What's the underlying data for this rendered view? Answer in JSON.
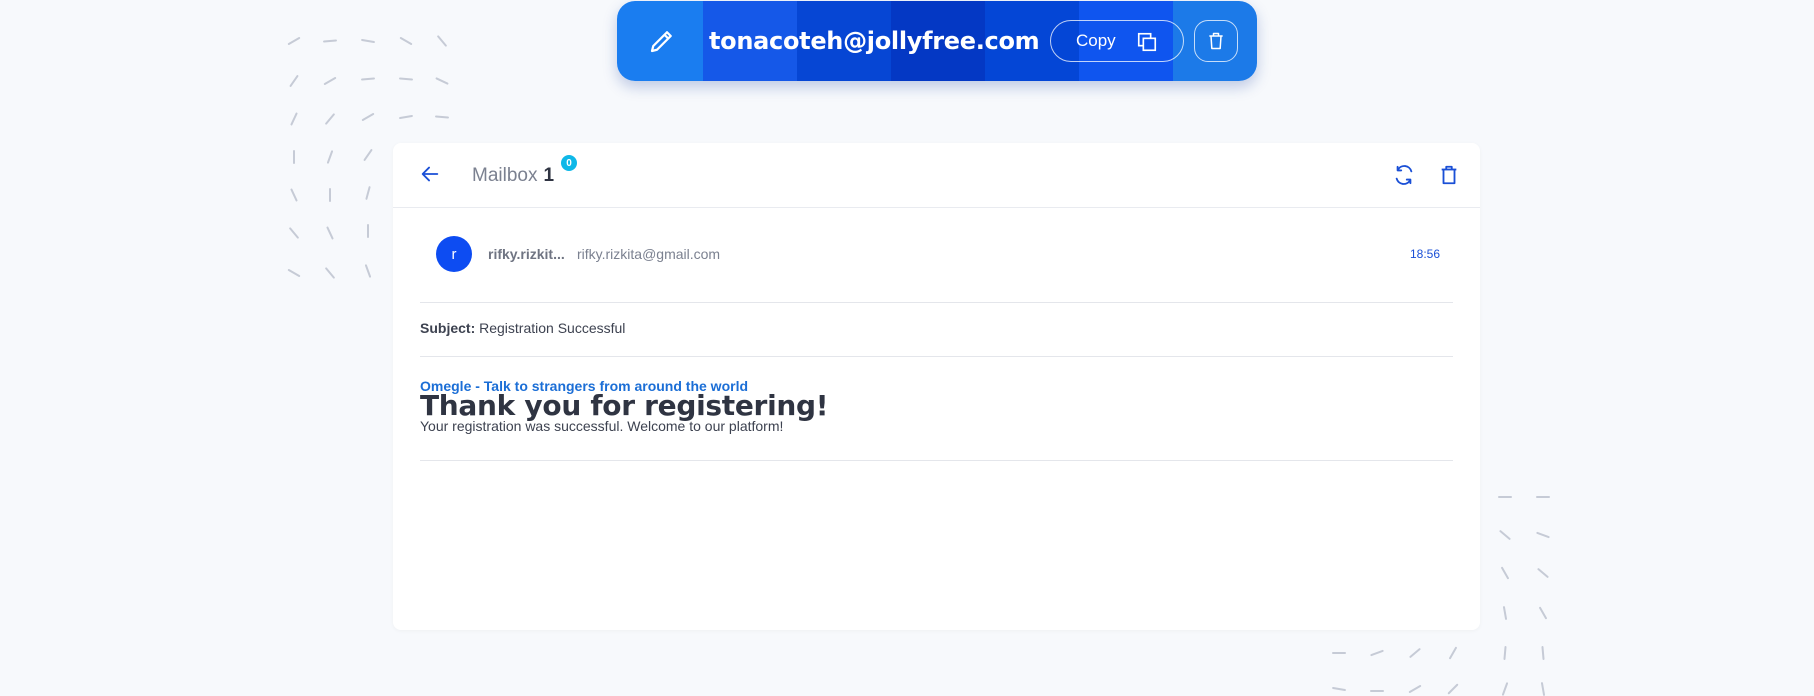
{
  "topbar": {
    "email": "tonacoteh@jollyfree.com",
    "copy_label": "Copy",
    "colors": [
      "#1a7df0",
      "#1558e8",
      "#0646d4",
      "#0438c4",
      "#0446d6",
      "#0f55ef",
      "#1c7ae8"
    ]
  },
  "mailbox": {
    "title": "Mailbox",
    "count": "1",
    "badge": "0"
  },
  "message": {
    "avatar_letter": "r",
    "sender_name": "rifky.rizkit...",
    "sender_email": "rifky.rizkita@gmail.com",
    "time": "18:56",
    "subject_label": "Subject:",
    "subject": "Registration Successful",
    "link_text": "Omegle - Talk to strangers from around the world",
    "heading": "Thank you for registering!",
    "body": "Your registration was successful. Welcome to our platform!"
  },
  "colors": {
    "accent": "#0d4cf2",
    "background": "#f7f9fc"
  },
  "icons": [
    "pencil-icon",
    "copy-icon",
    "trash-icon",
    "back-arrow-icon",
    "refresh-icon",
    "delete-icon"
  ]
}
